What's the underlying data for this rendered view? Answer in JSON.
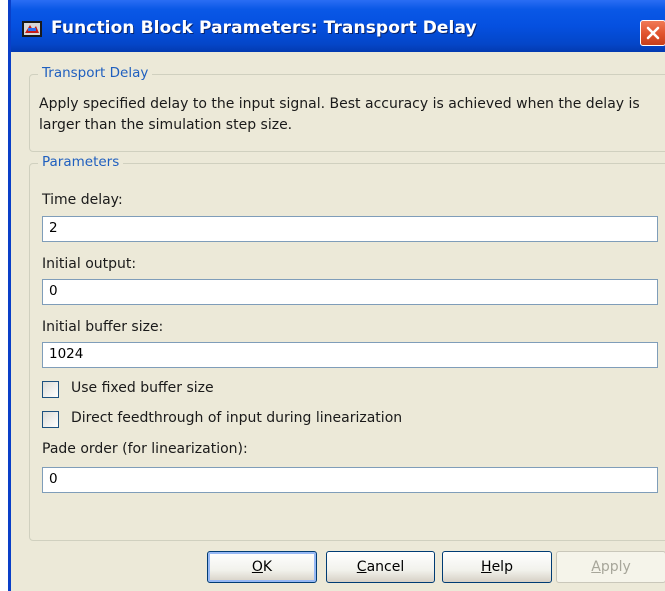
{
  "window": {
    "title": "Function Block Parameters: Transport Delay"
  },
  "block_group": {
    "title": "Transport Delay",
    "description": "Apply specified delay to the input signal.  Best accuracy is achieved when the delay is larger than the simulation step size."
  },
  "parameters": {
    "title": "Parameters",
    "time_delay": {
      "label": "Time delay:",
      "value": "2"
    },
    "initial_output": {
      "label": "Initial output:",
      "value": "0"
    },
    "initial_buffer_size": {
      "label": "Initial buffer size:",
      "value": "1024"
    },
    "use_fixed_buffer": {
      "label": "Use fixed buffer size",
      "checked": false
    },
    "direct_feedthrough": {
      "label": "Direct feedthrough of input during linearization",
      "checked": false
    },
    "pade_order": {
      "label": "Pade order (for linearization):",
      "value": "0"
    }
  },
  "buttons": {
    "ok": {
      "mnemonic": "O",
      "rest": "K"
    },
    "cancel": {
      "mnemonic": "C",
      "rest": "ancel"
    },
    "help": {
      "mnemonic": "H",
      "rest": "elp"
    },
    "apply": {
      "mnemonic": "A",
      "rest": "pply",
      "enabled": false
    }
  },
  "colors": {
    "titlebar": "#0550e0",
    "close": "#e0532e",
    "group_title": "#1f5fbf",
    "dialog_bg": "#ece9d8"
  }
}
